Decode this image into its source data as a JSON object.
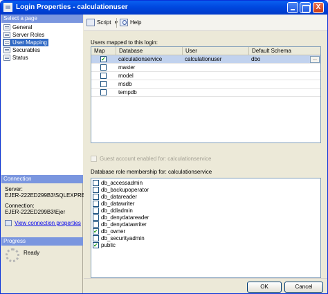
{
  "window": {
    "title": "Login Properties - calculationuser",
    "minimize_label": "",
    "maximize_label": "",
    "close_label": "X"
  },
  "left_pane": {
    "select_page_header": "Select a page",
    "pages": [
      "General",
      "Server Roles",
      "User Mapping",
      "Securables",
      "Status"
    ],
    "selected_page": "User Mapping",
    "connection_header": "Connection",
    "server_label": "Server:",
    "server_value": "EJER-222ED299B3\\SQLEXPRES",
    "connection_label": "Connection:",
    "connection_value": "EJER-222ED299B3\\Ejer",
    "view_connection_link": "View connection properties",
    "progress_header": "Progress",
    "progress_status": "Ready"
  },
  "toolbar": {
    "script_label": "Script",
    "script_icon": "script-icon",
    "help_label": "Help",
    "help_icon": "help-icon"
  },
  "users_mapped": {
    "label": "Users mapped to this login:",
    "columns": [
      "Map",
      "Database",
      "User",
      "Default Schema"
    ],
    "rows": [
      {
        "mapped": true,
        "database": "calculationservice",
        "user": "calculationuser",
        "schema": "dbo",
        "ellipsis": "..."
      },
      {
        "mapped": false,
        "database": "master",
        "user": "",
        "schema": ""
      },
      {
        "mapped": false,
        "database": "model",
        "user": "",
        "schema": ""
      },
      {
        "mapped": false,
        "database": "msdb",
        "user": "",
        "schema": ""
      },
      {
        "mapped": false,
        "database": "tempdb",
        "user": "",
        "schema": ""
      }
    ]
  },
  "guest": {
    "label": "Guest account enabled for: calculationservice",
    "checked": false
  },
  "roles": {
    "label": "Database role membership for: calculationservice",
    "items": [
      {
        "name": "db_accessadmin",
        "checked": false
      },
      {
        "name": "db_backupoperator",
        "checked": false
      },
      {
        "name": "db_datareader",
        "checked": false
      },
      {
        "name": "db_datawriter",
        "checked": false
      },
      {
        "name": "db_ddladmin",
        "checked": false
      },
      {
        "name": "db_denydatareader",
        "checked": false
      },
      {
        "name": "db_denydatawriter",
        "checked": false
      },
      {
        "name": "db_owner",
        "checked": true
      },
      {
        "name": "db_securityadmin",
        "checked": false
      },
      {
        "name": "public",
        "checked": true
      }
    ]
  },
  "buttons": {
    "ok": "OK",
    "cancel": "Cancel"
  },
  "colors": {
    "title_bar": "#0054e3",
    "selection": "#316ac5",
    "pane_header": "#7a96df",
    "dialog_bg": "#ece9d8"
  }
}
